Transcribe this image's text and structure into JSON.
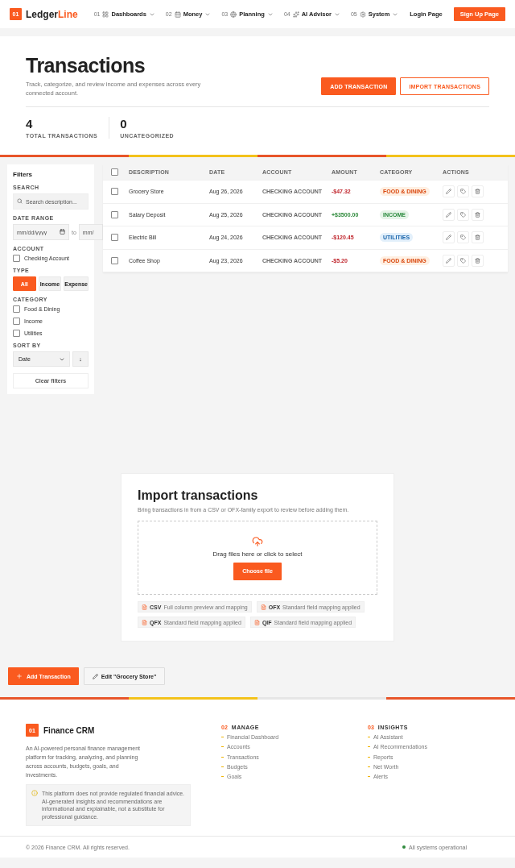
{
  "nav": {
    "logo_badge": "01",
    "logo_main": "Ledger",
    "logo_accent": "Line",
    "items": [
      {
        "num": "01",
        "label": "Dashboards"
      },
      {
        "num": "02",
        "label": "Money"
      },
      {
        "num": "03",
        "label": "Planning"
      },
      {
        "num": "04",
        "label": "AI Advisor"
      },
      {
        "num": "05",
        "label": "System"
      }
    ],
    "login": "Login Page",
    "signup": "Sign Up Page"
  },
  "hero": {
    "title": "Transactions",
    "subtitle": "Track, categorize, and review income and expenses across every connected account.",
    "primary": "ADD TRANSACTION",
    "secondary": "IMPORT TRANSACTIONS",
    "stats": [
      {
        "value": "4",
        "label": "TOTAL TRANSACTIONS"
      },
      {
        "value": "0",
        "label": "UNCATEGORIZED"
      }
    ]
  },
  "filters": {
    "title": "Filters",
    "search_label": "SEARCH",
    "search_placeholder": "Search description...",
    "date_label": "DATE RANGE",
    "date_from_placeholder": "mm/dd/yyyy",
    "date_sep": "to",
    "date_to_placeholder": "mm/",
    "account_label": "ACCOUNT",
    "accounts": [
      {
        "label": "Checking Account",
        "checked": false
      }
    ],
    "type_label": "TYPE",
    "types": [
      {
        "label": "All",
        "selected": true
      },
      {
        "label": "Income",
        "selected": false
      },
      {
        "label": "Expense",
        "selected": false
      }
    ],
    "category_label": "CATEGORY",
    "categories": [
      {
        "label": "Food & Dining",
        "checked": false
      },
      {
        "label": "Income",
        "checked": false
      },
      {
        "label": "Utilities",
        "checked": false
      }
    ],
    "sort_label": "SORT BY",
    "sort_value": "Date",
    "sort_dir": "↓",
    "clear": "Clear filters"
  },
  "table": {
    "select_all": false,
    "columns": [
      "DESCRIPTION",
      "DATE",
      "ACCOUNT",
      "AMOUNT",
      "CATEGORY",
      "ACTIONS"
    ],
    "rows": [
      {
        "checked": false,
        "description": "Grocery Store",
        "date": "Aug 26, 2026",
        "account": "CHECKING ACCOUNT",
        "amount": "-$47.32",
        "kind": "expense",
        "category": {
          "label": "FOOD & DINING",
          "kind": "food"
        }
      },
      {
        "checked": false,
        "description": "Salary Deposit",
        "date": "Aug 25, 2026",
        "account": "CHECKING ACCOUNT",
        "amount": "+$3500.00",
        "kind": "income",
        "category": {
          "label": "INCOME",
          "kind": "income"
        }
      },
      {
        "checked": false,
        "description": "Electric Bill",
        "date": "Aug 24, 2026",
        "account": "CHECKING ACCOUNT",
        "amount": "-$120.45",
        "kind": "expense",
        "category": {
          "label": "UTILITIES",
          "kind": "utilities"
        }
      },
      {
        "checked": false,
        "description": "Coffee Shop",
        "date": "Aug 23, 2026",
        "account": "CHECKING ACCOUNT",
        "amount": "-$5.20",
        "kind": "expense",
        "category": {
          "label": "FOOD & DINING",
          "kind": "food"
        }
      }
    ]
  },
  "import": {
    "title": "Import transactions",
    "subtitle": "Bring transactions in from a CSV or OFX-family export to review before adding them.",
    "drop_text": "Drag files here or click to select",
    "button": "Choose file",
    "formats": [
      {
        "name": "CSV",
        "note": "Full column preview and mapping"
      },
      {
        "name": "OFX",
        "note": "Standard field mapping applied"
      },
      {
        "name": "QFX",
        "note": "Standard field mapping applied"
      },
      {
        "name": "QIF",
        "note": "Standard field mapping applied"
      }
    ]
  },
  "actions": {
    "add": "Add Transaction",
    "edit": "Edit \"Grocery Store\""
  },
  "footer": {
    "badge": "01",
    "brand": "Finance CRM",
    "description": "An AI-powered personal finance management platform for tracking, analyzing, and planning across accounts, budgets, goals, and investments.",
    "notice": "This platform does not provide regulated financial advice. AI-generated insights and recommendations are informational and explainable, not a substitute for professional guidance.",
    "columns": [
      {
        "num": "02",
        "title": "MANAGE",
        "links": [
          "Financial Dashboard",
          "Accounts",
          "Transactions",
          "Budgets",
          "Goals"
        ]
      },
      {
        "num": "03",
        "title": "INSIGHTS",
        "links": [
          "AI Assistant",
          "AI Recommendations",
          "Reports",
          "Net Worth",
          "Alerts"
        ]
      }
    ],
    "copyright": "© 2026 Finance CRM. All rights reserved.",
    "status": "All systems operational"
  }
}
